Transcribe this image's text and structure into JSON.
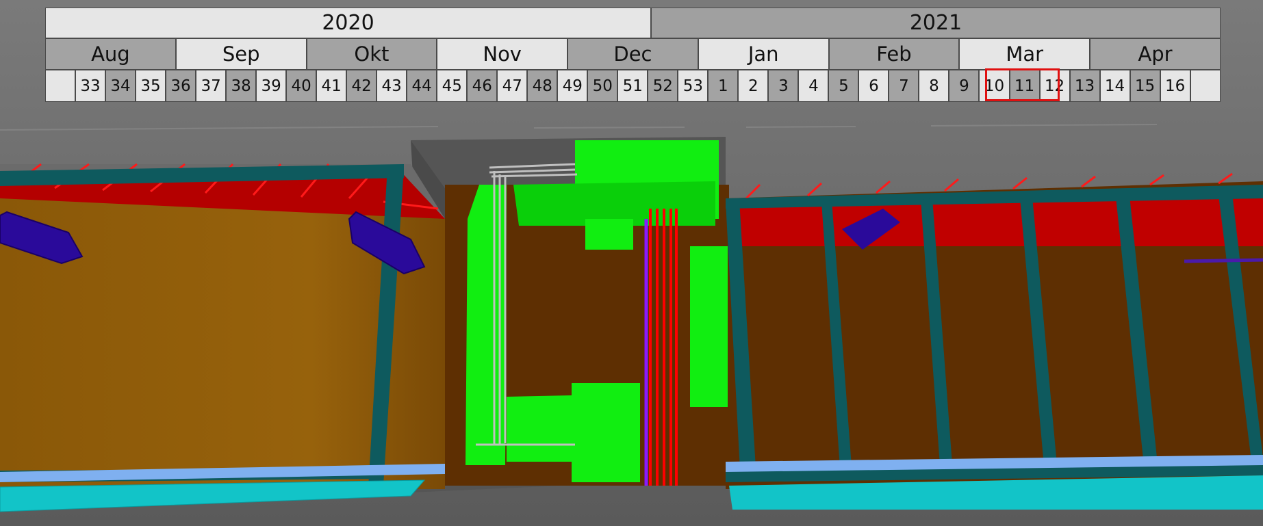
{
  "timeline": {
    "years": [
      {
        "label": "2020",
        "weeks": 22
      },
      {
        "label": "2021",
        "weeks": 17
      }
    ],
    "months": [
      {
        "label": "Aug",
        "weeks": 4
      },
      {
        "label": "Sep",
        "weeks": 4
      },
      {
        "label": "Okt",
        "weeks": 4
      },
      {
        "label": "Nov",
        "weeks": 4
      },
      {
        "label": "Dec",
        "weeks": 4
      },
      {
        "label": "Jan",
        "weeks": 4
      },
      {
        "label": "Feb",
        "weeks": 4
      },
      {
        "label": "Mar",
        "weeks": 4
      },
      {
        "label": "Apr",
        "weeks": 4
      }
    ],
    "weeks": [
      "",
      "33",
      "34",
      "35",
      "36",
      "37",
      "38",
      "39",
      "40",
      "41",
      "42",
      "43",
      "44",
      "45",
      "46",
      "47",
      "48",
      "49",
      "50",
      "51",
      "52",
      "53",
      "1",
      "2",
      "3",
      "4",
      "5",
      "6",
      "7",
      "8",
      "9",
      "10",
      "11",
      "12",
      "13",
      "14",
      "15",
      "16",
      ""
    ],
    "current_weeks": [
      "10",
      "11",
      "12"
    ]
  },
  "colors": {
    "highlight": "#e01010",
    "cell_light": "#e6e6e6",
    "cell_dark": "#a3a3a3",
    "wall_orange": "#8f5b0c",
    "frame_teal": "#0e5a5e",
    "rebar_red": "#d40000",
    "formwork_green": "#11ee11",
    "pipe_blue": "#2a0a9a",
    "piles_cyan": "#12c4c8",
    "floor_brown": "#5e2f02"
  }
}
